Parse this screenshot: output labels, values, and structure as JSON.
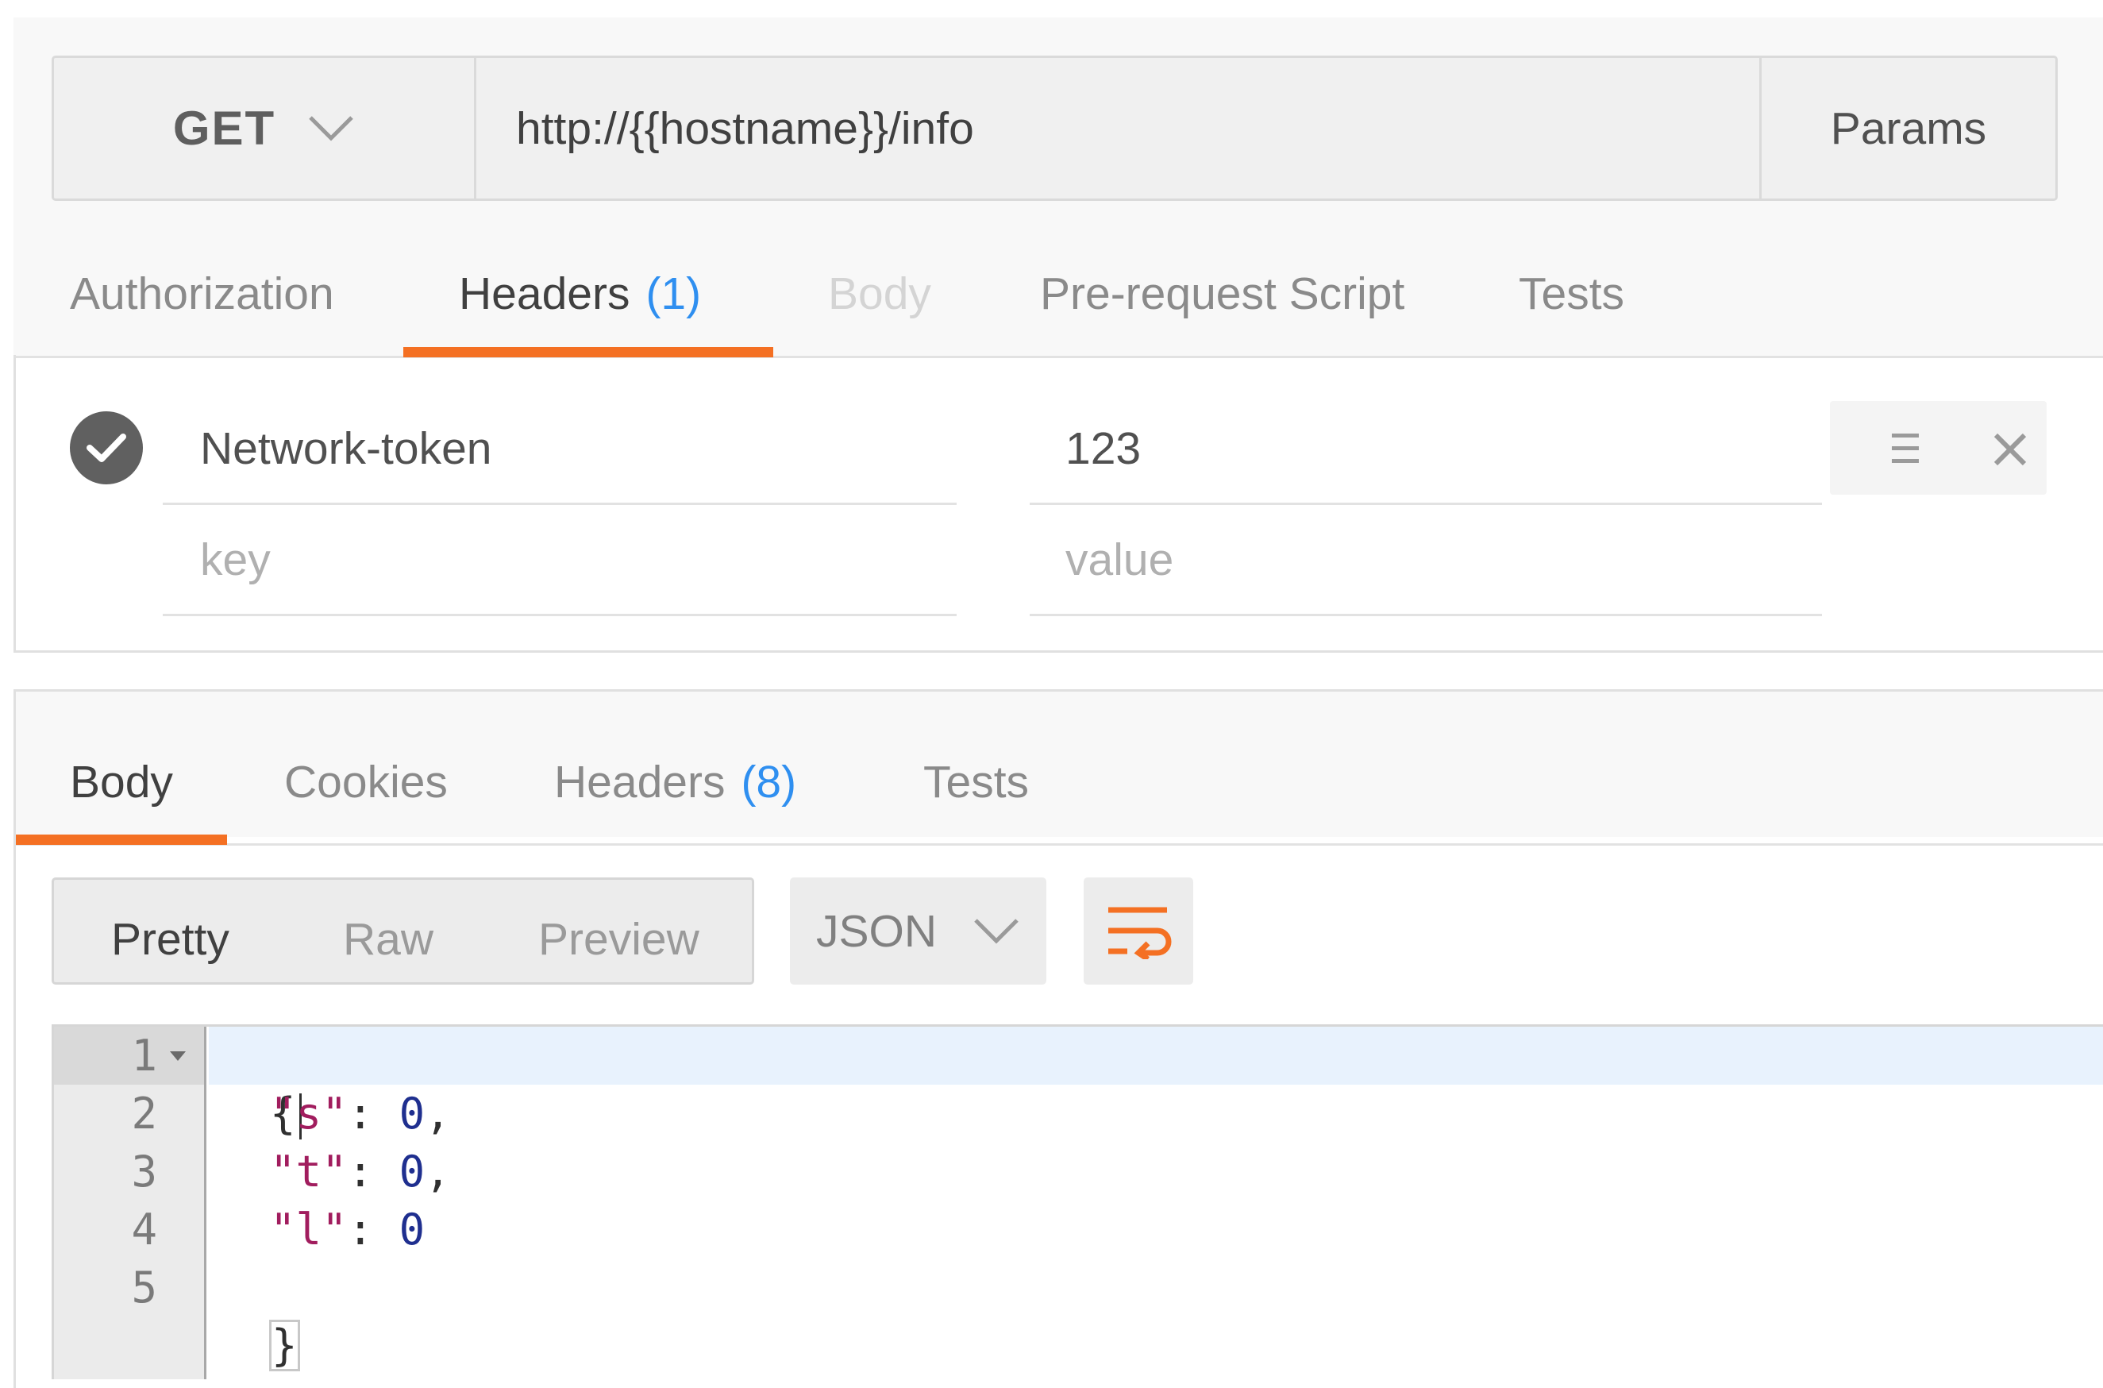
{
  "request": {
    "method": "GET",
    "url": "http://{{hostname}}/info",
    "params_label": "Params",
    "tabs": [
      {
        "label": "Authorization",
        "count": ""
      },
      {
        "label": "Headers",
        "count": "(1)"
      },
      {
        "label": "Body",
        "count": ""
      },
      {
        "label": "Pre-request Script",
        "count": ""
      },
      {
        "label": "Tests",
        "count": ""
      }
    ],
    "active_tab": "Headers",
    "headers": [
      {
        "key": "Network-token",
        "value": "123",
        "enabled": true
      }
    ],
    "new_row": {
      "key_placeholder": "key",
      "value_placeholder": "value"
    }
  },
  "response": {
    "tabs": [
      {
        "label": "Body",
        "count": ""
      },
      {
        "label": "Cookies",
        "count": ""
      },
      {
        "label": "Headers",
        "count": "(8)"
      },
      {
        "label": "Tests",
        "count": ""
      }
    ],
    "active_tab": "Body",
    "view_modes": [
      "Pretty",
      "Raw",
      "Preview"
    ],
    "active_view": "Pretty",
    "format": "JSON",
    "code": {
      "line_numbers": [
        "1",
        "2",
        "3",
        "4",
        "5"
      ],
      "open_brace": "{",
      "close_brace": "}",
      "entries": [
        {
          "key": "\"s\"",
          "value": "0",
          "comma": ","
        },
        {
          "key": "\"t\"",
          "value": "0",
          "comma": ","
        },
        {
          "key": "\"l\"",
          "value": "0",
          "comma": ""
        }
      ]
    }
  },
  "colors": {
    "accent": "#f47023",
    "count": "#2f8ff0",
    "json_key": "#a11d5e",
    "json_number": "#1f2f8f",
    "active_line": "#e8f2fd"
  },
  "icons": {
    "method_dropdown": "chevron-down-icon",
    "header_enabled": "check-circle-icon",
    "row_menu": "hamburger-icon",
    "row_delete": "close-icon",
    "format_dropdown": "chevron-down-icon",
    "wrap": "wrap-lines-icon",
    "fold": "fold-caret-icon"
  }
}
